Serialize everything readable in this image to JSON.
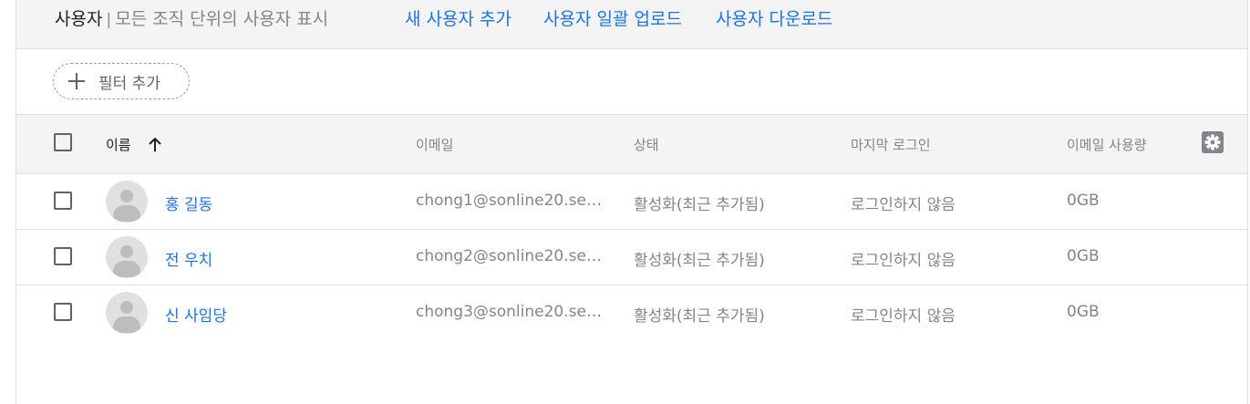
{
  "topbar": {
    "title": "사용자",
    "separator": "|",
    "subtitle": "모든 조직 단위의 사용자 표시",
    "actions": [
      {
        "label": "새 사용자 추가"
      },
      {
        "label": "사용자 일괄 업로드"
      },
      {
        "label": "사용자 다운로드"
      }
    ]
  },
  "filter": {
    "chip_label": "필터 추가"
  },
  "table": {
    "columns": {
      "name": "이름",
      "email": "이메일",
      "status": "상태",
      "last_login": "마지막 로그인",
      "usage": "이메일 사용량"
    },
    "rows": [
      {
        "name": "홍 길동",
        "email": "chong1@sonline20.sen.g...",
        "status": "활성화(최근 추가됨)",
        "last_login": "로그인하지 않음",
        "usage": "0GB"
      },
      {
        "name": "전 우치",
        "email": "chong2@sonline20.sen.g...",
        "status": "활성화(최근 추가됨)",
        "last_login": "로그인하지 않음",
        "usage": "0GB"
      },
      {
        "name": "신 사임당",
        "email": "chong3@sonline20.sen.g...",
        "status": "활성화(최근 추가됨)",
        "last_login": "로그인하지 않음",
        "usage": "0GB"
      }
    ]
  },
  "icons": {
    "add": "plus-icon",
    "sort": "arrow-up-icon",
    "settings": "gear-icon",
    "avatar": "avatar-placeholder-icon"
  },
  "colors": {
    "link": "#1a73e8",
    "muted_text": "#80868b",
    "header_bg": "#f4f4f4"
  }
}
